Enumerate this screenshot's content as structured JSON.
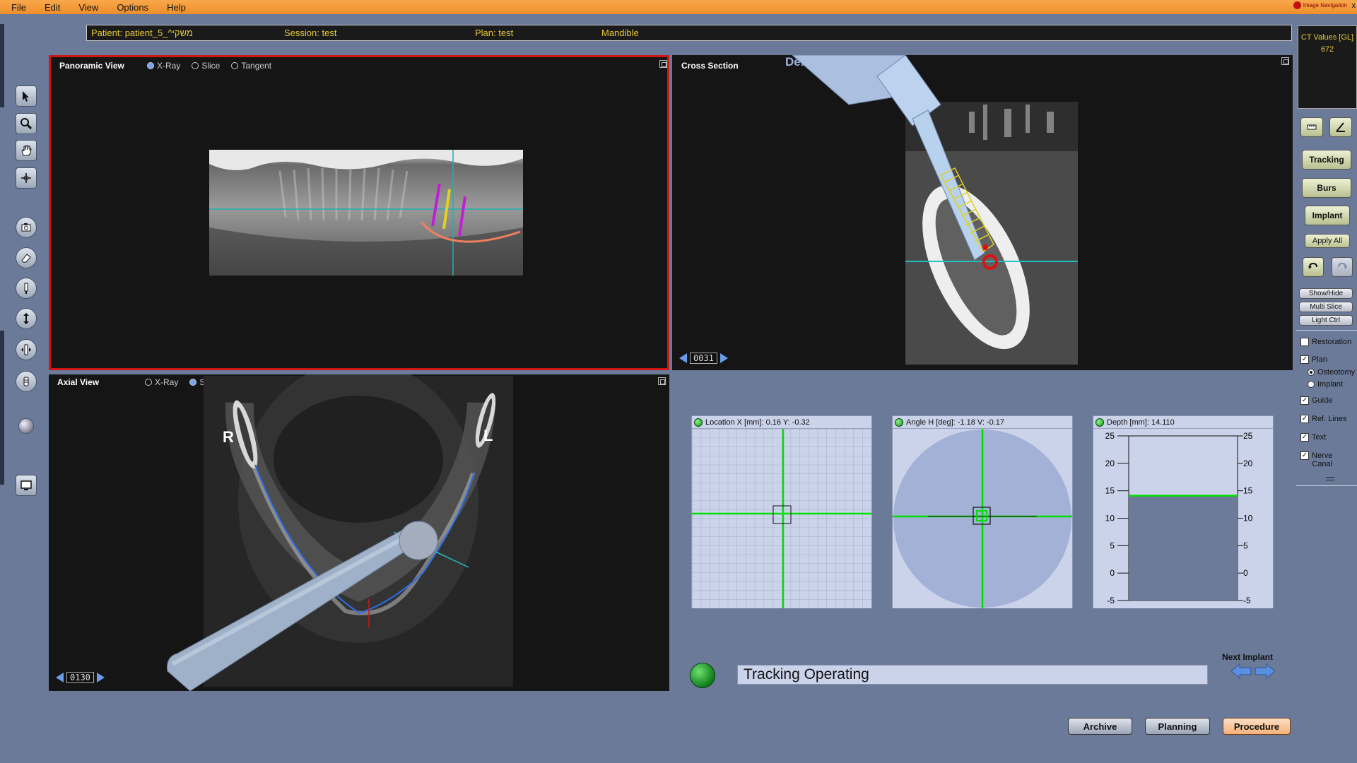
{
  "menu": [
    "File",
    "Edit",
    "View",
    "Options",
    "Help"
  ],
  "logo_text": "Image Navigation",
  "window_close": "x",
  "info": {
    "patient": "Patient: patient_5_^משקי",
    "session": "Session: test",
    "plan": "Plan: test",
    "region": "Mandible"
  },
  "ct": {
    "label": "CT Values [GL]",
    "value": "672"
  },
  "panoramic": {
    "title": "Panoramic View",
    "options": [
      {
        "label": "X-Ray",
        "selected": true
      },
      {
        "label": "Slice",
        "selected": false
      },
      {
        "label": "Tangent",
        "selected": false
      }
    ]
  },
  "cross": {
    "title": "Cross Section",
    "subtitle": "Dental Section",
    "slice": "0031"
  },
  "axial": {
    "title": "Axial View",
    "options": [
      {
        "label": "X-Ray",
        "selected": false
      },
      {
        "label": "Slice",
        "selected": true
      }
    ],
    "slice": "0130",
    "right_marker": "R",
    "left_marker": "L"
  },
  "gauges": {
    "location": "Location X [mm]: 0.16 Y: -0.32",
    "angle": "Angle H [deg]: -1.18 V: -0.17",
    "depth": "Depth [mm]: 14.110",
    "depth_value": 14.11,
    "depth_ticks": [
      "25",
      "20",
      "15",
      "10",
      "5",
      "0",
      "-5"
    ]
  },
  "status": "Tracking Operating",
  "next_implant": "Next Implant",
  "right_buttons": {
    "tracking": "Tracking",
    "burs": "Burs",
    "implant": "Implant",
    "apply_all": "Apply All",
    "show_hide": "Show/Hide",
    "multi_slice": "Multi Slice",
    "light_ctrl": "Light Ctrl"
  },
  "checks": {
    "restoration": "Restoration",
    "plan": "Plan",
    "osteotomy": "Osteotomy",
    "implant": "Implant",
    "guide": "Guide",
    "ref_lines": "Ref. Lines",
    "text": "Text",
    "nerve_canal_1": "Nerve",
    "nerve_canal_2": "Canal"
  },
  "bottom": {
    "archive": "Archive",
    "planning": "Planning",
    "procedure": "Procedure"
  },
  "colors": {
    "menubar": "#ee8f2a",
    "info_text": "#e6c83a",
    "active_border": "#d01515",
    "track_green": "#00e000"
  }
}
